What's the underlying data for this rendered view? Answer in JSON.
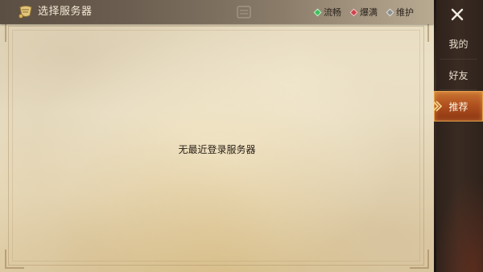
{
  "header": {
    "title": "选择服务器"
  },
  "legend": [
    {
      "label": "流畅",
      "color": "#3dbf5a"
    },
    {
      "label": "爆满",
      "color": "#d0414a"
    },
    {
      "label": "维护",
      "color": "#8e8e8e"
    }
  ],
  "sidebar": {
    "close_icon": "close-icon",
    "tabs": [
      {
        "label": "我的"
      },
      {
        "label": "好友"
      },
      {
        "label": "推荐"
      }
    ],
    "selected_tab": "推荐"
  },
  "main": {
    "empty_message": "无最近登录服务器"
  },
  "colors": {
    "accent_tab": "#b0511f",
    "parchment": "#ede3c9"
  }
}
